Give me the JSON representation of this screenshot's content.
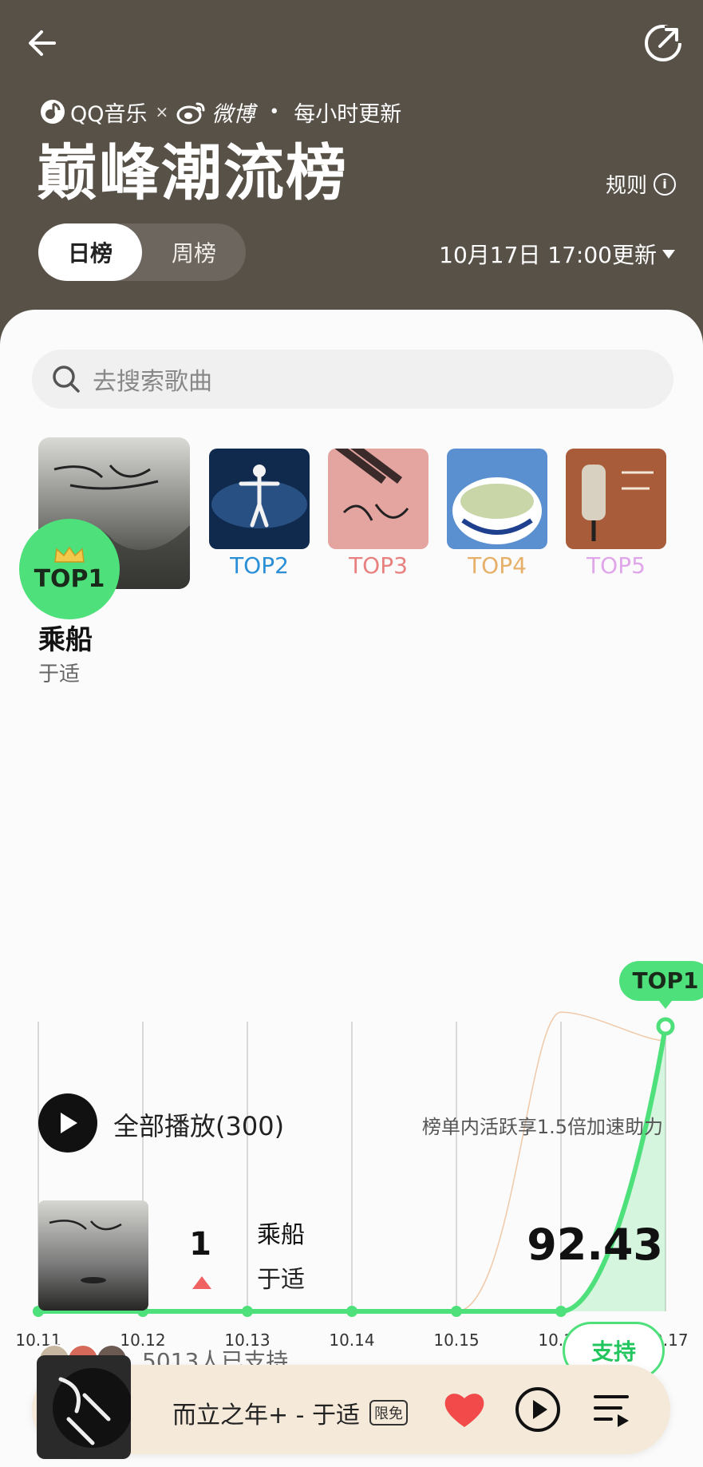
{
  "header": {
    "brand_qq": "QQ音乐",
    "brand_x": "×",
    "brand_weibo": "微博",
    "brand_dot": "•",
    "update_freq": "每小时更新",
    "title": "巅峰潮流榜",
    "rules_label": "规则",
    "tabs": [
      {
        "label": "日榜",
        "active": true
      },
      {
        "label": "周榜",
        "active": false
      }
    ],
    "update_time": "10月17日 17:00更新"
  },
  "search": {
    "placeholder": "去搜索歌曲"
  },
  "top_covers": {
    "top1_label": "TOP1",
    "others": [
      {
        "label": "TOP2",
        "color": "#2a8fd6"
      },
      {
        "label": "TOP3",
        "color": "#e88080"
      },
      {
        "label": "TOP4",
        "color": "#e6b06a"
      },
      {
        "label": "TOP5",
        "color": "#e0a6ea"
      }
    ]
  },
  "featured_song": {
    "title": "乘船",
    "artist": "于适"
  },
  "chart_data": {
    "type": "line",
    "x": [
      "10.11",
      "10.12",
      "10.13",
      "10.14",
      "10.15",
      "10.16",
      "10.17"
    ],
    "series": [
      {
        "values": [
          0,
          0,
          0,
          0,
          0,
          0,
          1
        ]
      },
      {
        "values": [
          0,
          0,
          0,
          0,
          0,
          1.05,
          0.95
        ]
      }
    ],
    "peak_label": "TOP1",
    "colors": {
      "main": "#4ee07a",
      "secondary": "#f0c9a8"
    }
  },
  "play_all": {
    "label": "全部播放(300)",
    "boost_text": "榜单内活跃享1.5倍加速助力"
  },
  "song_row": {
    "rank": "1",
    "title": "乘船",
    "artist": "于适",
    "score": "92.43",
    "trend": "up"
  },
  "supporters": {
    "text": "5013人已支持",
    "button": "支持"
  },
  "player": {
    "title": "而立之年+ - 于适",
    "badge": "限免"
  }
}
